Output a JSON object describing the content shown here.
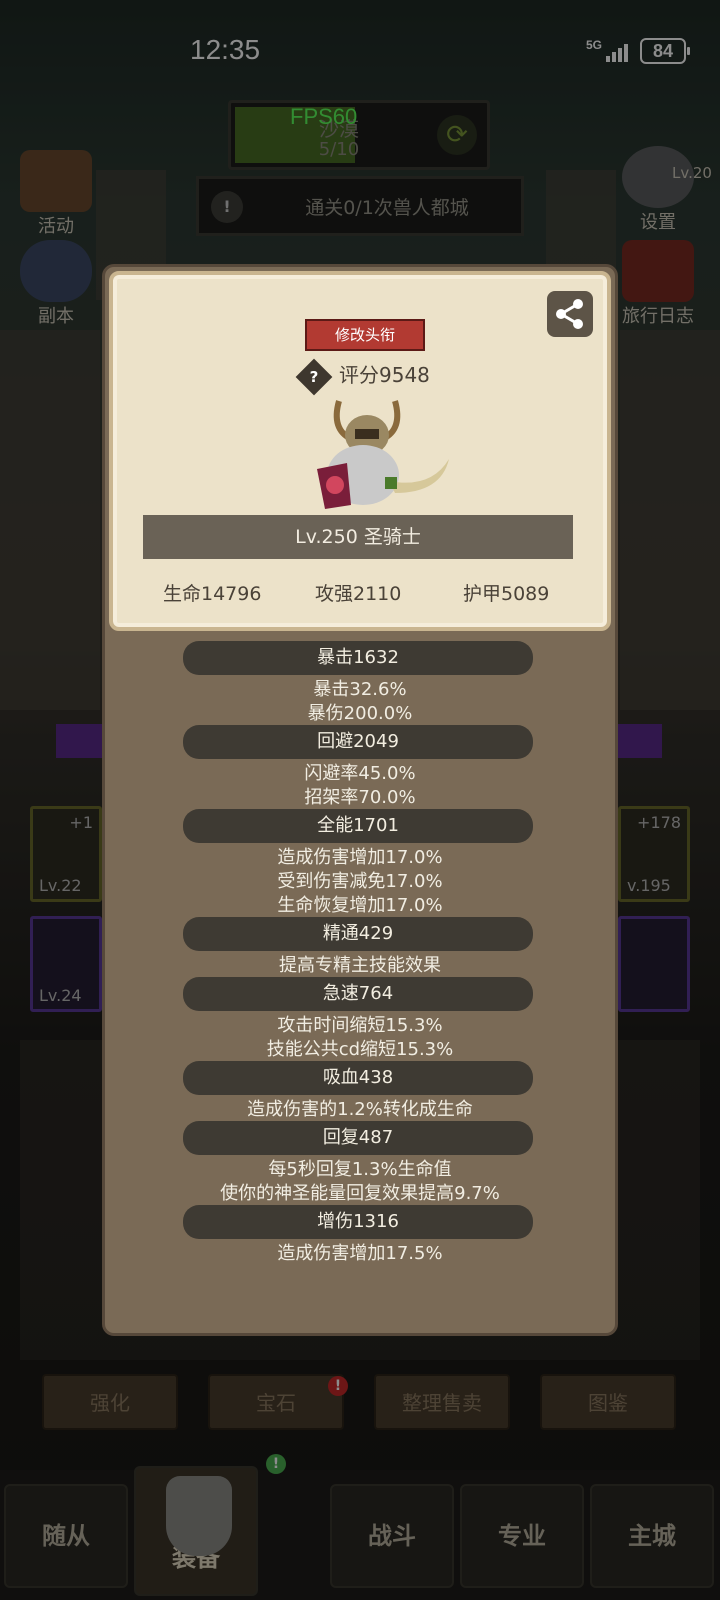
{
  "status_bar": {
    "time": "12:35",
    "network": "5G",
    "battery": "84"
  },
  "hud": {
    "fps": "FPS60",
    "stage_name": "沙漠",
    "stage_progress": "5/10",
    "quest": "通关0/1次兽人都城"
  },
  "side_buttons": {
    "left_top": "活动",
    "left_mid": "副本",
    "right_top": "设置",
    "right_top_level": "Lv.20",
    "right_mid": "旅行日志"
  },
  "equipment_slots": [
    {
      "top": "+1",
      "bottom": "Lv.22"
    },
    {
      "top": "",
      "bottom": "Lv.24"
    },
    {
      "top": "+178",
      "bottom": "v.195"
    },
    {
      "top": "",
      "bottom": ""
    }
  ],
  "action_buttons": [
    "强化",
    "宝石",
    "整理售卖",
    "图鉴"
  ],
  "nav": [
    "随从",
    "装备",
    "战斗",
    "专业",
    "主城"
  ],
  "profile": {
    "rename_label": "修改头衔",
    "score_label": "评分9548",
    "help_icon": "?",
    "name": "Lv.250 圣骑士",
    "hp": "生命14796",
    "attack": "攻强2110",
    "armor": "护甲5089"
  },
  "attributes": [
    {
      "title": "暴击1632",
      "lines": [
        "暴击32.6%",
        "暴伤200.0%"
      ]
    },
    {
      "title": "回避2049",
      "lines": [
        "闪避率45.0%",
        "招架率70.0%"
      ]
    },
    {
      "title": "全能1701",
      "lines": [
        "造成伤害增加17.0%",
        "受到伤害减免17.0%",
        "生命恢复增加17.0%"
      ]
    },
    {
      "title": "精通429",
      "lines": [
        "提高专精主技能效果"
      ]
    },
    {
      "title": "急速764",
      "lines": [
        "攻击时间缩短15.3%",
        "技能公共cd缩短15.3%"
      ]
    },
    {
      "title": "吸血438",
      "lines": [
        "造成伤害的1.2%转化成生命"
      ]
    },
    {
      "title": "回复487",
      "lines": [
        "每5秒回复1.3%生命值",
        "使你的神圣能量回复效果提高9.7%"
      ]
    },
    {
      "title": "增伤1316",
      "lines": [
        "造成伤害增加17.5%"
      ]
    }
  ],
  "colors": {
    "accent_red": "#b23a32",
    "fps_green": "#5cff5c",
    "panel": "#7a6a56",
    "card": "#ece2c9"
  }
}
